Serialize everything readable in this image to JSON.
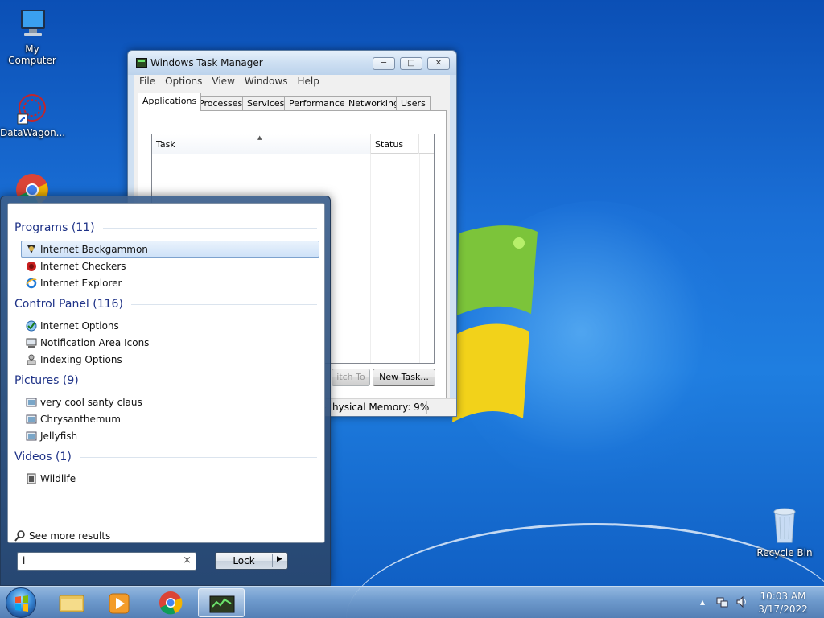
{
  "desktop": {
    "icons": [
      {
        "label": "My Computer"
      },
      {
        "label": "DataWagon..."
      },
      {
        "label": "Recycle Bin"
      }
    ]
  },
  "task_manager": {
    "title": "Windows Task Manager",
    "menu": [
      "File",
      "Options",
      "View",
      "Windows",
      "Help"
    ],
    "tabs": [
      "Applications",
      "Processes",
      "Services",
      "Performance",
      "Networking",
      "Users"
    ],
    "active_tab": "Applications",
    "columns": {
      "task": "Task",
      "status": "Status"
    },
    "buttons": {
      "switch_to": "itch To",
      "new_task": "New Task..."
    },
    "status_text": "hysical Memory: 9%"
  },
  "start_menu": {
    "groups": [
      {
        "title": "Programs (11)",
        "items": [
          {
            "label": "Internet Backgammon",
            "icon": "backgammon-icon",
            "selected": true
          },
          {
            "label": "Internet Checkers",
            "icon": "checkers-icon"
          },
          {
            "label": "Internet Explorer",
            "icon": "internet-explorer-icon"
          }
        ]
      },
      {
        "title": "Control Panel (116)",
        "items": [
          {
            "label": "Internet Options",
            "icon": "internet-options-icon"
          },
          {
            "label": "Notification Area Icons",
            "icon": "notification-icons-icon"
          },
          {
            "label": "Indexing Options",
            "icon": "indexing-options-icon"
          }
        ]
      },
      {
        "title": "Pictures (9)",
        "items": [
          {
            "label": "very cool santy claus",
            "icon": "picture-icon"
          },
          {
            "label": "Chrysanthemum",
            "icon": "picture-icon"
          },
          {
            "label": "Jellyfish",
            "icon": "picture-icon"
          }
        ]
      },
      {
        "title": "Videos (1)",
        "items": [
          {
            "label": "Wildlife",
            "icon": "video-icon"
          }
        ]
      }
    ],
    "see_more": "See more results",
    "search": {
      "value": "i"
    },
    "lock_label": "Lock"
  },
  "taskbar": {
    "pinned": [
      "windows-explorer-icon",
      "media-player-icon",
      "chrome-icon",
      "task-manager-icon"
    ],
    "time": "10:03 AM",
    "date": "3/17/2022"
  }
}
